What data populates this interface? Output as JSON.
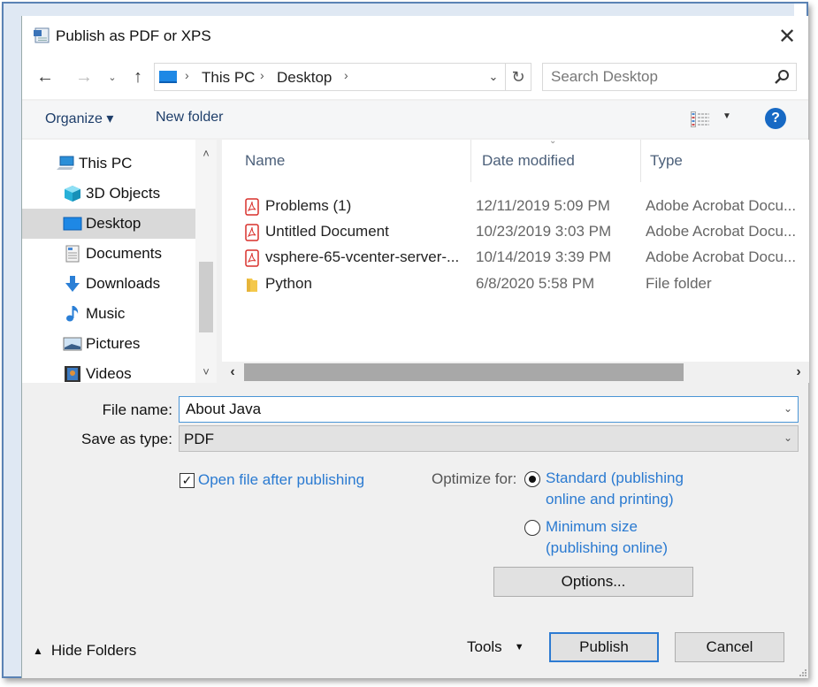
{
  "window": {
    "title": "Publish as PDF or XPS",
    "close_label": "✕"
  },
  "nav": {
    "back_glyph": "←",
    "forward_glyph": "→",
    "recent_glyph": "⌄",
    "up_glyph": "↑",
    "breadcrumb": [
      "This PC",
      "Desktop"
    ],
    "separator": "›",
    "dropdown_glyph": "⌄",
    "refresh_glyph": "↻"
  },
  "search": {
    "placeholder": "Search Desktop"
  },
  "toolbar": {
    "organize_label": "Organize ▾",
    "new_folder_label": "New folder",
    "view_dropdown_glyph": "▼",
    "help_label": "?"
  },
  "sidebar": {
    "items": [
      {
        "label": "This PC",
        "icon": "computer-icon",
        "selected": false
      },
      {
        "label": "3D Objects",
        "icon": "3d-objects-icon",
        "selected": false
      },
      {
        "label": "Desktop",
        "icon": "desktop-icon",
        "selected": true
      },
      {
        "label": "Documents",
        "icon": "documents-icon",
        "selected": false
      },
      {
        "label": "Downloads",
        "icon": "downloads-icon",
        "selected": false
      },
      {
        "label": "Music",
        "icon": "music-icon",
        "selected": false
      },
      {
        "label": "Pictures",
        "icon": "pictures-icon",
        "selected": false
      },
      {
        "label": "Videos",
        "icon": "videos-icon",
        "selected": false
      }
    ],
    "scroll_up_glyph": "˄",
    "scroll_down_glyph": "˅"
  },
  "files": {
    "columns": [
      "Name",
      "Date modified",
      "Type"
    ],
    "sort_glyph": "⌄",
    "rows": [
      {
        "name": "Problems (1)",
        "date": "12/11/2019 5:09 PM",
        "type": "Adobe Acrobat Docu...",
        "icon": "pdf-icon"
      },
      {
        "name": "Untitled Document",
        "date": "10/23/2019 3:03 PM",
        "type": "Adobe Acrobat Docu...",
        "icon": "pdf-icon"
      },
      {
        "name": "vsphere-65-vcenter-server-...",
        "date": "10/14/2019 3:39 PM",
        "type": "Adobe Acrobat Docu...",
        "icon": "pdf-icon"
      },
      {
        "name": "Python",
        "date": "6/8/2020 5:58 PM",
        "type": "File folder",
        "icon": "folder-icon"
      }
    ],
    "scroll_left_glyph": "‹",
    "scroll_right_glyph": "›"
  },
  "form": {
    "file_name_label": "File name:",
    "file_name_value": "About Java",
    "save_as_type_label": "Save as type:",
    "save_as_type_value": "PDF",
    "dropdown_glyph": "⌄",
    "open_after_label": "Open file after publishing",
    "open_after_checked": true,
    "check_glyph": "✓",
    "optimize_label": "Optimize for:",
    "optimize_options": [
      {
        "line1": "Standard (publishing",
        "line2": "online and printing)",
        "selected": true
      },
      {
        "line1": "Minimum size",
        "line2": "(publishing online)",
        "selected": false
      }
    ],
    "options_button": "Options..."
  },
  "footer": {
    "hide_folders_label": "Hide Folders",
    "hide_folders_glyph": "▲",
    "tools_label": "Tools",
    "tools_glyph": "▼",
    "publish_label": "Publish",
    "cancel_label": "Cancel"
  },
  "colors": {
    "accent_blue": "#2a7ad1",
    "focus_border": "#2d7bd2",
    "help_blue": "#1769c4",
    "pdf_red": "#d9302c",
    "folder_yellow": "#f4c84b",
    "selected_bg": "#d9d9d9"
  }
}
